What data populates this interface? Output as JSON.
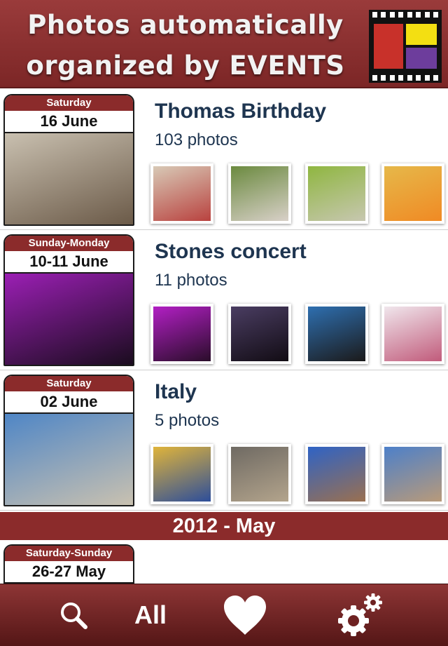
{
  "banner": {
    "line1": "Photos automatically",
    "line2": "organized by EVENTS",
    "logo_icon": "film-calendar-logo-icon"
  },
  "events": [
    {
      "day": "Saturday",
      "date": "16 June",
      "title": "Thomas Birthday",
      "count": "103 photos",
      "cover_colors": [
        "#c9c0b0",
        "#6b5a48"
      ],
      "thumbs": [
        [
          "#d8c9b6",
          "#b9423f"
        ],
        [
          "#6b8a3f",
          "#d8d0c8"
        ],
        [
          "#8fb640",
          "#c7c7b0"
        ],
        [
          "#e6b84a",
          "#f08a24"
        ]
      ]
    },
    {
      "day": "Sunday-Monday",
      "date": "10-11 June",
      "title": "Stones concert",
      "count": "11 photos",
      "cover_colors": [
        "#9b1fb4",
        "#1a0c1e"
      ],
      "thumbs": [
        [
          "#b21fc4",
          "#2a0d2a"
        ],
        [
          "#4a3d62",
          "#120c14"
        ],
        [
          "#2e6fb0",
          "#1b1a1a"
        ],
        [
          "#f0e6ec",
          "#c15b7b"
        ]
      ]
    },
    {
      "day": "Saturday",
      "date": "02 June",
      "title": "Italy",
      "count": "5 photos",
      "cover_colors": [
        "#4f86c6",
        "#c9c1b0"
      ],
      "thumbs": [
        [
          "#e0b43a",
          "#2d4e9a"
        ],
        [
          "#6f6a63",
          "#b3a48c"
        ],
        [
          "#2f63c5",
          "#9a7050"
        ],
        [
          "#4d80c9",
          "#b89a7a"
        ]
      ]
    },
    {
      "day": "Saturday-Sunday",
      "date": "26-27 May"
    }
  ],
  "section": {
    "label": "2012 - May"
  },
  "tabbar": {
    "search_icon": "search-icon",
    "all_label": "All",
    "favorites_icon": "heart-icon",
    "settings_icon": "gear-icon"
  },
  "colors": {
    "brand": "#8b2b2b",
    "title_text": "#1e3550"
  }
}
